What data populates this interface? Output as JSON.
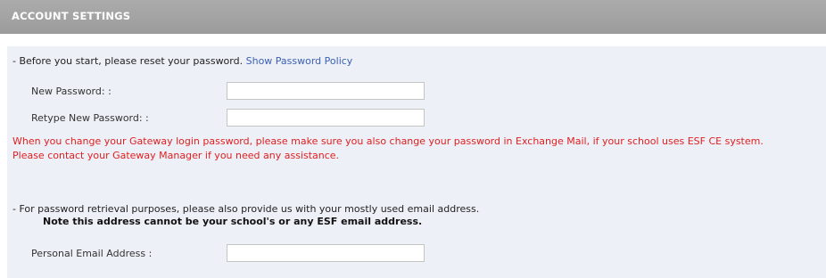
{
  "header": {
    "title": "ACCOUNT SETTINGS"
  },
  "password_section": {
    "intro_text": "- Before you start, please reset your password.",
    "policy_link": "Show Password Policy",
    "new_password_label": "New Password: :",
    "new_password_value": "",
    "retype_password_label": "Retype New Password: :",
    "retype_password_value": "",
    "warning_line1": "When you change your Gateway login password, please make sure you also change your password in Exchange Mail, if your school uses ESF CE system.",
    "warning_line2": "Please contact your Gateway Manager if you need any assistance."
  },
  "email_section": {
    "intro_text": "- For password retrieval purposes, please also provide us with your mostly used email address.",
    "note_text": "Note this address cannot be your school's or any ESF email address.",
    "email_label": "Personal Email Address :",
    "email_value": ""
  },
  "colors": {
    "header_bg": "#a3a3a3",
    "panel_bg": "#eef0f7",
    "link": "#3a5fb4",
    "warning": "#e02020"
  }
}
